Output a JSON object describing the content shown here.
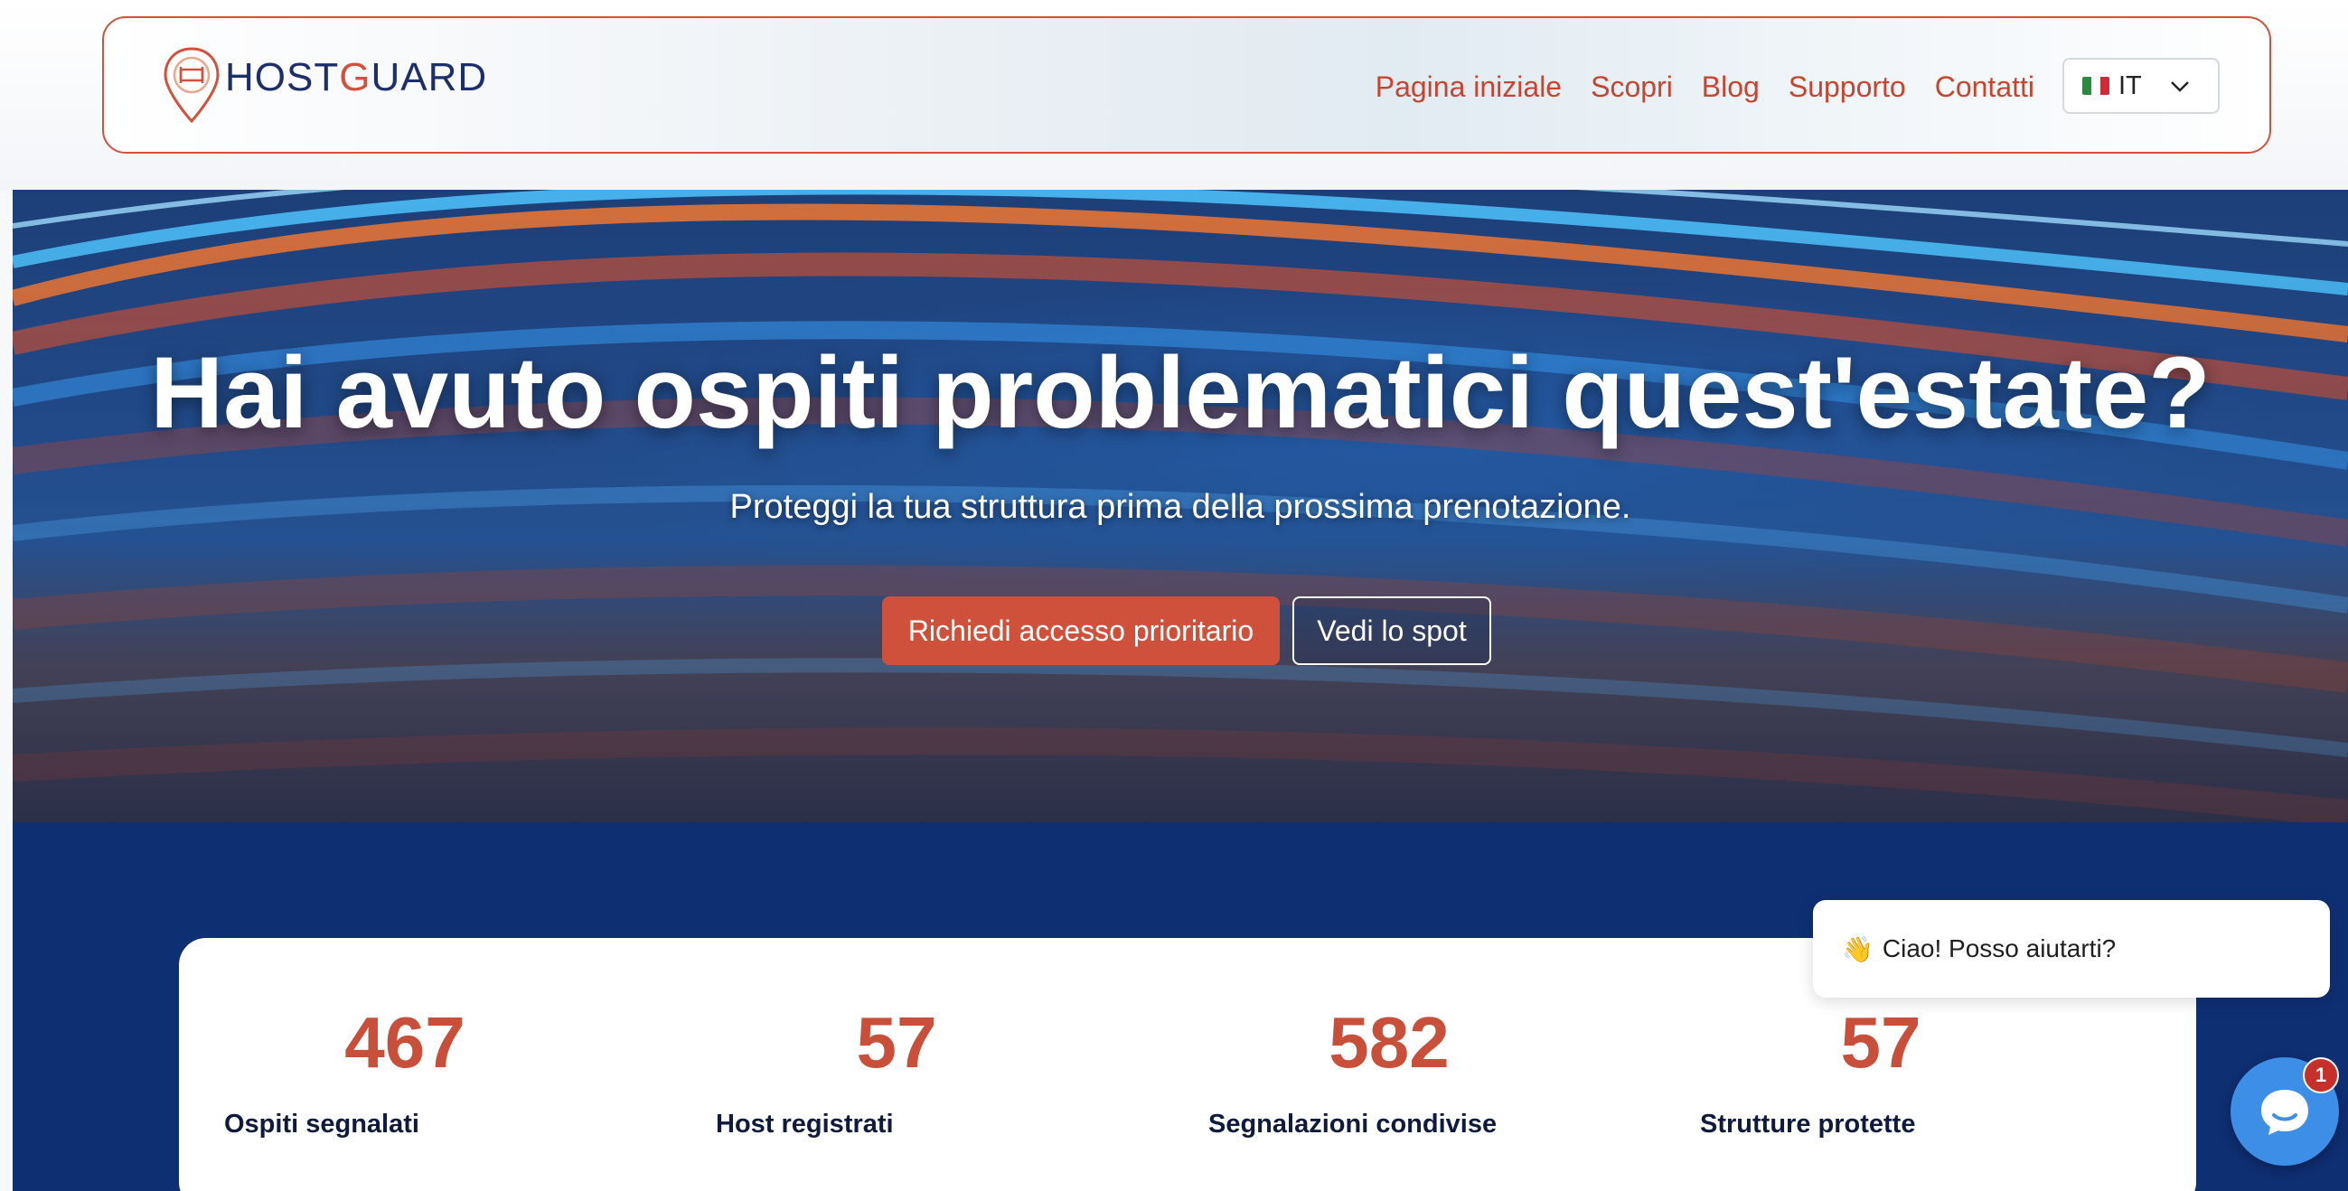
{
  "brand": {
    "name_part1": "HOST",
    "name_part2": "G",
    "name_part3": "UARD",
    "accent_color": "#d2513c",
    "brand_color": "#1d2f6b"
  },
  "nav": {
    "items": [
      {
        "label": "Pagina iniziale"
      },
      {
        "label": "Scopri"
      },
      {
        "label": "Blog"
      },
      {
        "label": "Supporto"
      },
      {
        "label": "Contatti"
      }
    ],
    "language": {
      "code": "IT",
      "icon": "italy-flag-icon"
    }
  },
  "hero": {
    "title": "Hai avuto ospiti problematici quest'estate?",
    "subtitle": "Proteggi la tua struttura prima della prossima prenotazione.",
    "primary_cta": "Richiedi accesso prioritario",
    "secondary_cta": "Vedi lo spot"
  },
  "stats": [
    {
      "value": "467",
      "label": "Ospiti segnalati"
    },
    {
      "value": "57",
      "label": "Host registrati"
    },
    {
      "value": "582",
      "label": "Segnalazioni condivise"
    },
    {
      "value": "57",
      "label": "Strutture protette"
    }
  ],
  "chat": {
    "greeting_emoji": "👋",
    "greeting": "Ciao! Posso aiutarti?",
    "unread_count": "1"
  }
}
